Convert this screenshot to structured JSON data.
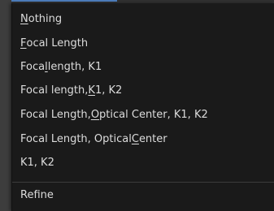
{
  "menu": {
    "items": [
      {
        "pre": "",
        "mn": "N",
        "post": "othing"
      },
      {
        "pre": "",
        "mn": "F",
        "post": "ocal Length"
      },
      {
        "pre": "Foca",
        "mn": "l",
        "post": " length, K1"
      },
      {
        "pre": "Focal length, ",
        "mn": "K",
        "post": "1, K2"
      },
      {
        "pre": "Focal Length, ",
        "mn": "O",
        "post": "ptical Center, K1, K2"
      },
      {
        "pre": "Focal Length, Optical ",
        "mn": "C",
        "post": "enter"
      },
      {
        "pre": "K1, K2",
        "mn": "",
        "post": ""
      },
      {
        "pre": "Refine",
        "mn": "",
        "post": ""
      }
    ]
  }
}
